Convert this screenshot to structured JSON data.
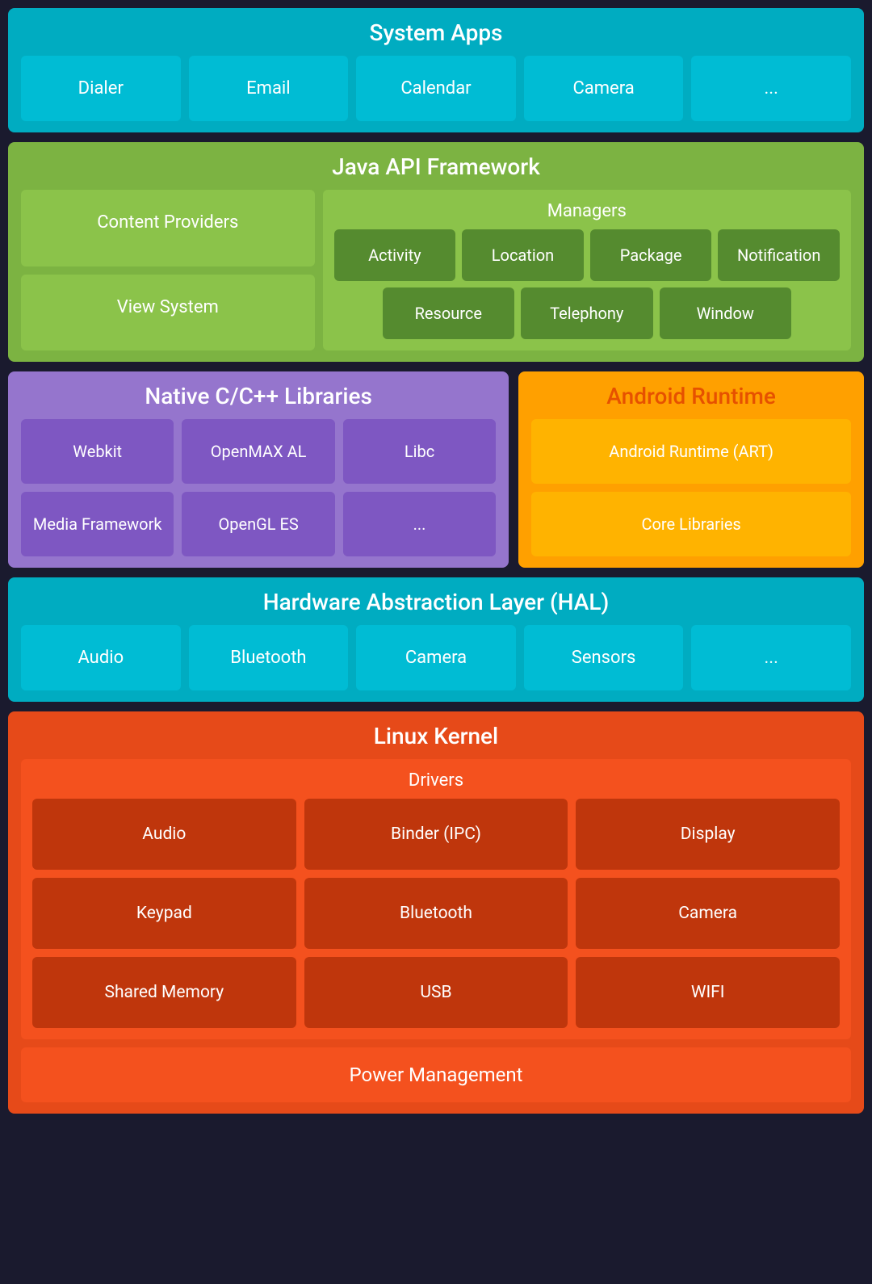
{
  "systemApps": {
    "title": "System Apps",
    "tiles": [
      "Dialer",
      "Email",
      "Calendar",
      "Camera",
      "..."
    ]
  },
  "javaApi": {
    "title": "Java API Framework",
    "left": {
      "tiles": [
        "Content Providers",
        "View System"
      ]
    },
    "managers": {
      "title": "Managers",
      "row1": [
        "Activity",
        "Location",
        "Package",
        "Notification"
      ],
      "row2": [
        "Resource",
        "Telephony",
        "Window"
      ]
    }
  },
  "nativeCpp": {
    "title": "Native C/C++ Libraries",
    "tiles": [
      "Webkit",
      "OpenMAX AL",
      "Libc",
      "Media Framework",
      "OpenGL ES",
      "..."
    ]
  },
  "androidRuntime": {
    "title": "Android Runtime",
    "tiles": [
      "Android Runtime (ART)",
      "Core Libraries"
    ]
  },
  "hal": {
    "title": "Hardware Abstraction Layer (HAL)",
    "tiles": [
      "Audio",
      "Bluetooth",
      "Camera",
      "Sensors",
      "..."
    ]
  },
  "linuxKernel": {
    "title": "Linux Kernel",
    "drivers": {
      "title": "Drivers",
      "tiles": [
        "Audio",
        "Binder (IPC)",
        "Display",
        "Keypad",
        "Bluetooth",
        "Camera",
        "Shared Memory",
        "USB",
        "WIFI"
      ]
    },
    "powerMgmt": "Power Management"
  }
}
